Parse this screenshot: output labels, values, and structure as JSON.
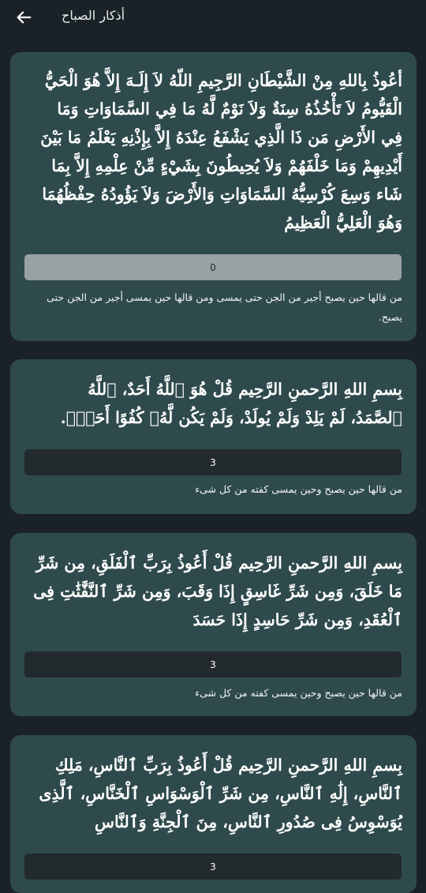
{
  "header": {
    "title": "أذكار الصباح",
    "back_icon": "arrow-left-icon"
  },
  "cards": [
    {
      "text": "أعُوذُ بِاللهِ مِنْ الشَّيْطَانِ الرَّجِيمِ اللّهُ لاَ إِلَـهَ إِلاَّ هُوَ الْحَيُّ الْقَيُّومُ لاَ تَأْخُذُهُ سِنَةٌ وَلاَ نَوْمٌ لَّهُ مَا فِي السَّمَاوَاتِ وَمَا فِي الأَرْضِ مَن ذَا الَّذِي يَشْفَعُ عِنْدَهُ إِلاَّ بِإِذْنِهِ يَعْلَمُ مَا بَيْنَ أَيْدِيهِمْ وَمَا خَلْفَهُمْ وَلاَ يُحِيطُونَ بِشَيْءٍ مِّنْ عِلْمِهِ إِلاَّ بِمَا شَاء وَسِعَ كُرْسِيُّهُ السَّمَاوَاتِ وَالأَرْضَ وَلاَ يَؤُودُهُ حِفْظُهُمَا وَهُوَ الْعَلِيُّ الْعَظِيمُ",
      "count": "0",
      "note": "من قالها حين يصبح أجير من الجن حتى يمسى ومن قالها حين يمسى أجير من الجن حتى يصبح."
    },
    {
      "text": "بِسمِ اللهِ الرَّحمنِ الرَّحِيم قُلْ هُوَ ٱللَّهُ أَحَدٌ، ٱللَّهُ ٱلصَّمَدُ، لَمْ يَلِدْ وَلَمْ يُولَدْ، وَلَمْ يَكُن لَّهُۥ كُفُوًا أَحَدٌۢ.",
      "count": "3",
      "note": "من قالها حين يصبح وحين يمسى كفته من كل شىء"
    },
    {
      "text": "بِسمِ اللهِ الرَّحمنِ الرَّحِيم قُلْ أَعُوذُ بِرَبِّ ٱلْفَلَقِ، مِن شَرِّ مَا خَلَقَ، وَمِن شَرِّ غَاسِقٍ إِذَا وَقَبَ، وَمِن شَرِّ ٱلنَّفَّٰثَٰتِ فِى ٱلْعُقَدِ، وَمِن شَرِّ حَاسِدٍ إِذَا حَسَدَ",
      "count": "3",
      "note": "من قالها حين يصبح وحين يمسى كفته من كل شىء"
    },
    {
      "text": "بِسمِ اللهِ الرَّحمنِ الرَّحِيم قُلْ أَعُوذُ بِرَبِّ ٱلنَّاسِ، مَلِكِ ٱلنَّاسِ، إِلَٰهِ ٱلنَّاسِ، مِن شَرِّ ٱلْوَسْوَاسِ ٱلْخَنَّاسِ، ٱلَّذِى يُوَسْوِسُ فِى صُدُورِ ٱلنَّاسِ، مِنَ ٱلْجِنَّةِ وَٱلنَّاسِ",
      "count": "3",
      "note": ""
    }
  ],
  "colors": {
    "background": "#1a2227",
    "card": "#2f4a4c",
    "counter_done": "#98a1a3",
    "counter_active": "#222a2d"
  }
}
